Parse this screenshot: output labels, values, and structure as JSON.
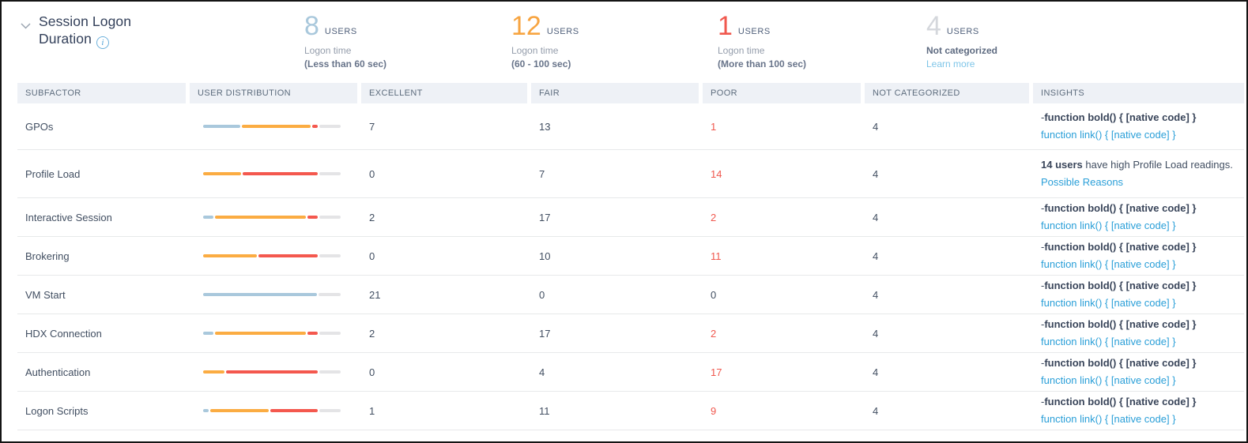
{
  "panel": {
    "title": "Session Logon Duration"
  },
  "summary": [
    {
      "count": "8",
      "unit": "USERS",
      "line1": "Logon time",
      "line2": "(Less than 60 sec)"
    },
    {
      "count": "12",
      "unit": "USERS",
      "line1": "Logon time",
      "line2": "(60 - 100 sec)"
    },
    {
      "count": "1",
      "unit": "USERS",
      "line1": "Logon time",
      "line2": "(More than 100 sec)"
    },
    {
      "count": "4",
      "unit": "USERS",
      "line1": "Not categorized",
      "line2": "Learn more"
    }
  ],
  "table": {
    "columns": [
      "SUBFACTOR",
      "USER DISTRIBUTION",
      "EXCELLENT",
      "FAIR",
      "POOR",
      "NOT CATEGORIZED",
      "INSIGHTS"
    ],
    "rows": [
      {
        "subfactor": "GPOs",
        "excellent": 7,
        "fair": 13,
        "poor": 1,
        "not_categorized": 4,
        "insight": "-"
      },
      {
        "subfactor": "Profile Load",
        "excellent": 0,
        "fair": 7,
        "poor": 14,
        "not_categorized": 4,
        "insight": {
          "bold": "14 users",
          "text": " have high Profile Load readings.",
          "link": "Possible Reasons"
        }
      },
      {
        "subfactor": "Interactive Session",
        "excellent": 2,
        "fair": 17,
        "poor": 2,
        "not_categorized": 4,
        "insight": "-"
      },
      {
        "subfactor": "Brokering",
        "excellent": 0,
        "fair": 10,
        "poor": 11,
        "not_categorized": 4,
        "insight": "-"
      },
      {
        "subfactor": "VM Start",
        "excellent": 21,
        "fair": 0,
        "poor": 0,
        "not_categorized": 4,
        "insight": "-"
      },
      {
        "subfactor": "HDX Connection",
        "excellent": 2,
        "fair": 17,
        "poor": 2,
        "not_categorized": 4,
        "insight": "-"
      },
      {
        "subfactor": "Authentication",
        "excellent": 0,
        "fair": 4,
        "poor": 17,
        "not_categorized": 4,
        "insight": "-"
      },
      {
        "subfactor": "Logon Scripts",
        "excellent": 1,
        "fair": 11,
        "poor": 9,
        "not_categorized": 4,
        "insight": "-"
      }
    ]
  },
  "colors": {
    "excellent": "#a9c8dc",
    "fair": "#fbac42",
    "poor": "#f4584e",
    "not_categorized": "#e4e4e6",
    "poor_text": "#f0584e",
    "link_blue": "#2a9fd8",
    "link_light_blue": "#7ec5e8"
  }
}
